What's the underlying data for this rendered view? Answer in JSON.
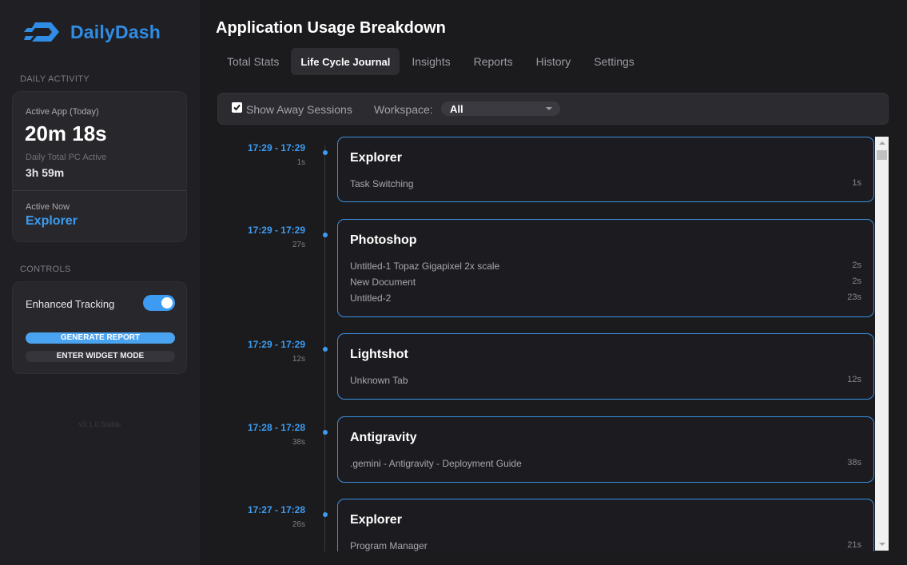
{
  "app": {
    "name": "DailyDash",
    "version": "v3.1.0 Stable"
  },
  "sidebar": {
    "daily_activity_label": "DAILY ACTIVITY",
    "active_app_label": "Active App (Today)",
    "active_app_time": "20m 18s",
    "daily_total_label": "Daily Total PC Active",
    "daily_total_time": "3h 59m",
    "active_now_label": "Active Now",
    "active_now_app": "Explorer",
    "controls_label": "CONTROLS",
    "enhanced_tracking_label": "Enhanced Tracking",
    "enhanced_tracking_on": true,
    "generate_report_label": "GENERATE REPORT",
    "widget_mode_label": "ENTER WIDGET MODE"
  },
  "main": {
    "title": "Application Usage Breakdown",
    "tabs": [
      {
        "label": "Total Stats",
        "active": false
      },
      {
        "label": "Life Cycle Journal",
        "active": true
      },
      {
        "label": "Insights",
        "active": false
      },
      {
        "label": "Reports",
        "active": false
      },
      {
        "label": "History",
        "active": false
      },
      {
        "label": "Settings",
        "active": false
      }
    ],
    "toolbar": {
      "show_away_label": "Show Away Sessions",
      "show_away_checked": true,
      "workspace_label": "Workspace:",
      "workspace_value": "All"
    },
    "entries": [
      {
        "time": "17:29 - 17:29",
        "duration": "1s",
        "app": "Explorer",
        "rows": [
          {
            "title": "Task Switching",
            "duration": "1s"
          }
        ]
      },
      {
        "time": "17:29 - 17:29",
        "duration": "27s",
        "app": "Photoshop",
        "rows": [
          {
            "title": "Untitled-1 Topaz Gigapixel 2x scale",
            "duration": "2s"
          },
          {
            "title": "New Document",
            "duration": "2s"
          },
          {
            "title": "Untitled-2",
            "duration": "23s"
          }
        ]
      },
      {
        "time": "17:29 - 17:29",
        "duration": "12s",
        "app": "Lightshot",
        "rows": [
          {
            "title": "Unknown Tab",
            "duration": "12s"
          }
        ]
      },
      {
        "time": "17:28 - 17:28",
        "duration": "38s",
        "app": "Antigravity",
        "rows": [
          {
            "title": ".gemini - Antigravity - Deployment Guide",
            "duration": "38s"
          }
        ]
      },
      {
        "time": "17:27 - 17:28",
        "duration": "26s",
        "app": "Explorer",
        "rows": [
          {
            "title": "Program Manager",
            "duration": "21s"
          }
        ]
      }
    ]
  },
  "colors": {
    "accent": "#3d9cf1",
    "brand": "#2f8de6",
    "background": "#1b1b1e",
    "sidebar": "#202024"
  }
}
